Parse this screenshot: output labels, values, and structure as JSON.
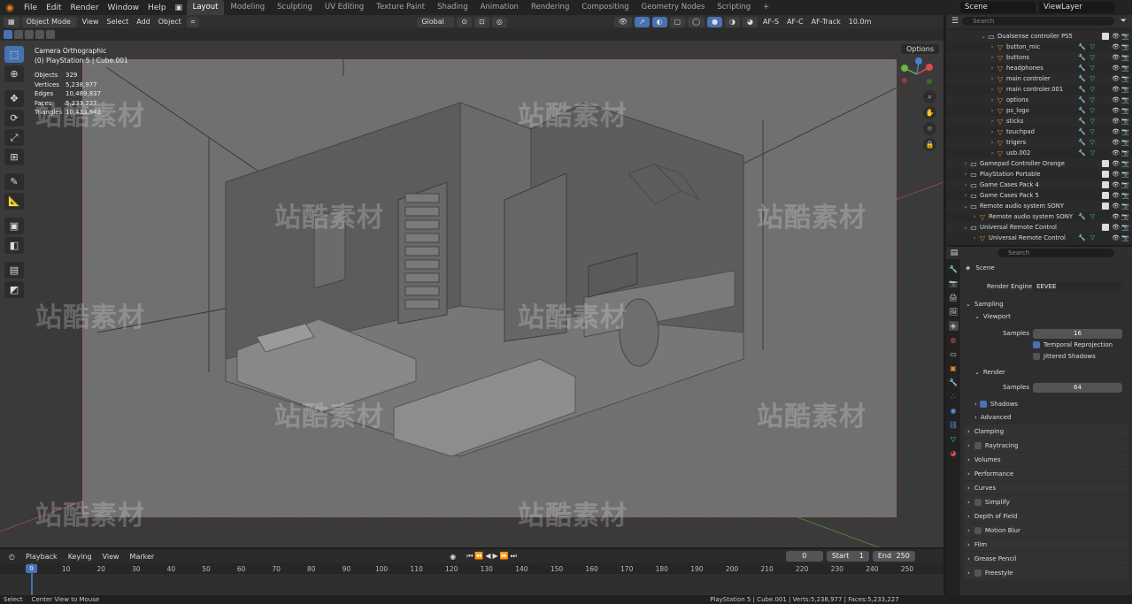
{
  "menu": {
    "items": [
      "File",
      "Edit",
      "Render",
      "Window",
      "Help"
    ],
    "workspaces": [
      "Layout",
      "Modeling",
      "Sculpting",
      "UV Editing",
      "Texture Paint",
      "Shading",
      "Animation",
      "Rendering",
      "Compositing",
      "Geometry Nodes",
      "Scripting"
    ],
    "active_workspace": "Layout",
    "add_tab": "+",
    "scene": "Scene",
    "view_layer": "ViewLayer"
  },
  "viewport_header": {
    "mode": "Object Mode",
    "menus": [
      "View",
      "Select",
      "Add",
      "Object"
    ],
    "orientation": "Global",
    "af_s": "AF-S",
    "af_c": "AF-C",
    "af_track": "AF-Track",
    "focal": "10.0m"
  },
  "viewport": {
    "camera_label": "Camera Orthographic",
    "object_label": "(0) PlayStation 5 | Cube.001",
    "options": "Options",
    "stats": [
      {
        "k": "Objects",
        "v": "329"
      },
      {
        "k": "Vertices",
        "v": "5,238,977"
      },
      {
        "k": "Edges",
        "v": "10,489,837"
      },
      {
        "k": "Faces",
        "v": "5,233,227"
      },
      {
        "k": "Triangles",
        "v": "10,433,642"
      }
    ],
    "watermark": "站酷素材"
  },
  "outliner": {
    "search_placeholder": "Search",
    "rows": [
      {
        "name": "Dualsense controller PS5",
        "indent": 3,
        "type": "coll",
        "arrow": "v"
      },
      {
        "name": "button_mic",
        "indent": 4,
        "type": "obj",
        "arrow": ">"
      },
      {
        "name": "buttons",
        "indent": 4,
        "type": "obj",
        "arrow": ">"
      },
      {
        "name": "headphones",
        "indent": 4,
        "type": "obj",
        "arrow": ">"
      },
      {
        "name": "main controler",
        "indent": 4,
        "type": "obj",
        "arrow": ">"
      },
      {
        "name": "main controler.001",
        "indent": 4,
        "type": "obj",
        "arrow": ">"
      },
      {
        "name": "options",
        "indent": 4,
        "type": "obj",
        "arrow": ">"
      },
      {
        "name": "ps_logo",
        "indent": 4,
        "type": "obj",
        "arrow": ">"
      },
      {
        "name": "sticks",
        "indent": 4,
        "type": "obj",
        "arrow": ">"
      },
      {
        "name": "touchpad",
        "indent": 4,
        "type": "obj",
        "arrow": ">"
      },
      {
        "name": "trigers",
        "indent": 4,
        "type": "obj",
        "arrow": ">"
      },
      {
        "name": "usb.002",
        "indent": 4,
        "type": "obj",
        "arrow": ">"
      },
      {
        "name": "Gamepad Controller Orange",
        "indent": 1,
        "type": "coll",
        "arrow": ">"
      },
      {
        "name": "PlayStation Portable",
        "indent": 1,
        "type": "coll",
        "arrow": ">"
      },
      {
        "name": "Game Cases Pack 4",
        "indent": 1,
        "type": "coll",
        "arrow": ">"
      },
      {
        "name": "Game Cases Pack 5",
        "indent": 1,
        "type": "coll",
        "arrow": ">"
      },
      {
        "name": "Remote audio system SONY",
        "indent": 1,
        "type": "coll",
        "arrow": "v"
      },
      {
        "name": "Remote audio system SONY",
        "indent": 2,
        "type": "obj",
        "arrow": ">"
      },
      {
        "name": "Universal Remote Control",
        "indent": 1,
        "type": "coll",
        "arrow": "v"
      },
      {
        "name": "Universal Remote Control",
        "indent": 2,
        "type": "obj",
        "arrow": ">"
      }
    ]
  },
  "properties": {
    "search_placeholder": "Search",
    "context": "Scene",
    "render_engine_label": "Render Engine",
    "render_engine": "EEVEE",
    "sampling": "Sampling",
    "viewport": "Viewport",
    "samples_label": "Samples",
    "viewport_samples": "16",
    "temporal_reprojection": "Temporal Reprojection",
    "jittered_shadows": "Jittered Shadows",
    "render": "Render",
    "render_samples": "64",
    "shadows": "Shadows",
    "advanced": "Advanced",
    "panels": [
      "Clamping",
      "Raytracing",
      "Volumes",
      "Performance",
      "Curves",
      "Simplify",
      "Depth of Field",
      "Motion Blur",
      "Film",
      "Grease Pencil",
      "Freestyle"
    ]
  },
  "timeline": {
    "menus": [
      "Playback",
      "Keying",
      "View",
      "Marker"
    ],
    "current_frame": "0",
    "start_label": "Start",
    "start": "1",
    "end_label": "End",
    "end": "250",
    "ticks": [
      "0",
      "10",
      "20",
      "30",
      "40",
      "50",
      "60",
      "70",
      "80",
      "90",
      "100",
      "110",
      "120",
      "130",
      "140",
      "150",
      "160",
      "170",
      "180",
      "190",
      "200",
      "210",
      "220",
      "230",
      "240",
      "250"
    ]
  },
  "status": {
    "select": "Select",
    "center_view": "Center View to Mouse",
    "info": "PlayStation 5 | Cube.001 | Verts:5,238,977 | Faces:5,233,227"
  },
  "colors": {
    "accent": "#4772b3",
    "object_icon": "#e08a2a",
    "modifier_icon": "#4a9be8",
    "mesh_icon": "#3fd39b"
  }
}
